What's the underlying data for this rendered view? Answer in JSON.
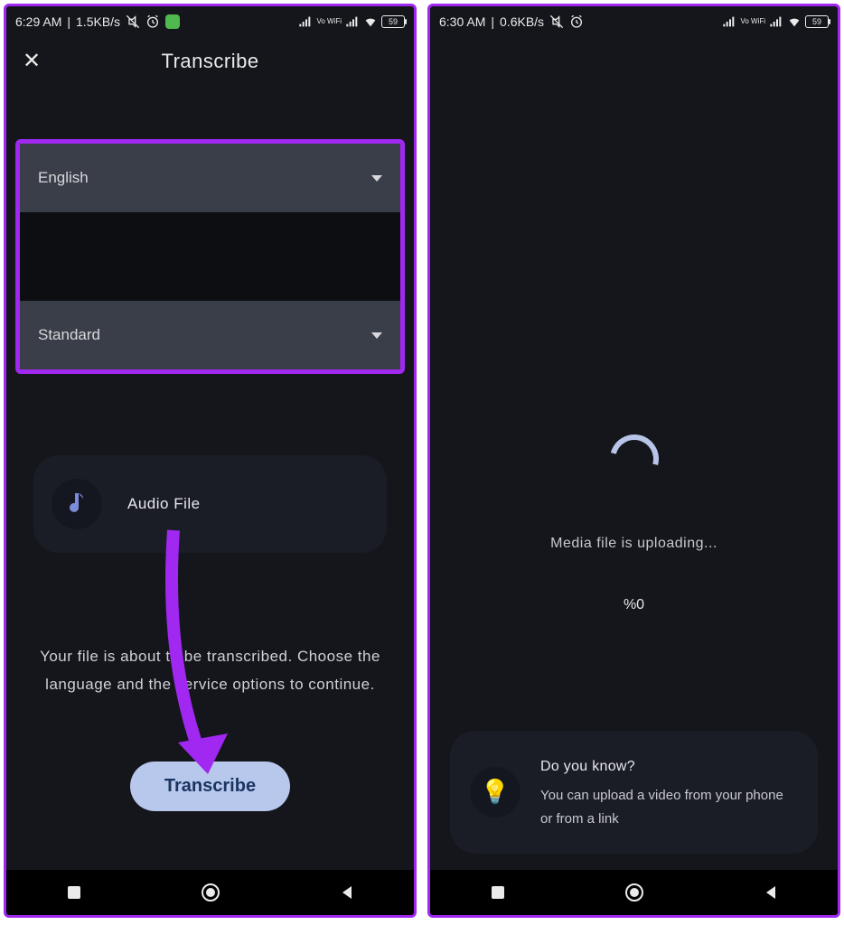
{
  "phone1": {
    "status": {
      "time": "6:29 AM",
      "speed": "1.5KB/s",
      "battery": "59"
    },
    "title": "Transcribe",
    "dropdown1": "English",
    "dropdown2": "Standard",
    "file_label": "Audio File",
    "instruction": "Your file is about to be transcribed. Choose the language and the service options to continue.",
    "cta": "Transcribe"
  },
  "phone2": {
    "status": {
      "time": "6:30 AM",
      "speed": "0.6KB/s",
      "battery": "59"
    },
    "uploading": "Media file is uploading...",
    "percent": "%0",
    "tip_title": "Do you know?",
    "tip_body": "You can upload a video from your phone or from a link"
  },
  "wifi_label": "Vo WiFi"
}
